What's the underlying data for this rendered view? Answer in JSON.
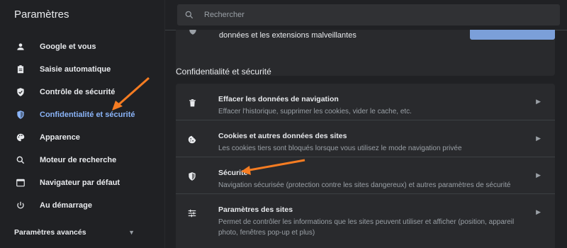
{
  "app": {
    "title": "Paramètres"
  },
  "search": {
    "placeholder": "Rechercher"
  },
  "sidebar": {
    "items": [
      {
        "label": "Google et vous",
        "icon": "person-icon",
        "active": false
      },
      {
        "label": "Saisie automatique",
        "icon": "clipboard-icon",
        "active": false
      },
      {
        "label": "Contrôle de sécurité",
        "icon": "shield-check-icon",
        "active": false
      },
      {
        "label": "Confidentialité et sécurité",
        "icon": "shield-icon",
        "active": true
      },
      {
        "label": "Apparence",
        "icon": "palette-icon",
        "active": false
      },
      {
        "label": "Moteur de recherche",
        "icon": "search-icon",
        "active": false
      },
      {
        "label": "Navigateur par défaut",
        "icon": "browser-icon",
        "active": false
      },
      {
        "label": "Au démarrage",
        "icon": "power-icon",
        "active": false
      }
    ],
    "advanced_label": "Paramètres avancés"
  },
  "top_card": {
    "text": "données et les extensions malveillantes"
  },
  "section": {
    "title": "Confidentialité et sécurité",
    "rows": [
      {
        "title": "Effacer les données de navigation",
        "subtitle": "Effacer l'historique, supprimer les cookies, vider le cache, etc.",
        "icon": "trash-icon"
      },
      {
        "title": "Cookies et autres données des sites",
        "subtitle": "Les cookies tiers sont bloqués lorsque vous utilisez le mode navigation privée",
        "icon": "cookie-icon"
      },
      {
        "title": "Sécurité",
        "subtitle": "Navigation sécurisée (protection contre les sites dangereux) et autres paramètres de sécurité",
        "icon": "shield-icon"
      },
      {
        "title": "Paramètres des sites",
        "subtitle": "Permet de contrôler les informations que les sites peuvent utiliser et afficher (position, appareil photo, fenêtres pop-up et plus)",
        "icon": "sliders-icon"
      }
    ]
  },
  "colors": {
    "background": "#202124",
    "card": "#292a2d",
    "accent": "#8ab4f8",
    "annotation": "#f57c22"
  }
}
